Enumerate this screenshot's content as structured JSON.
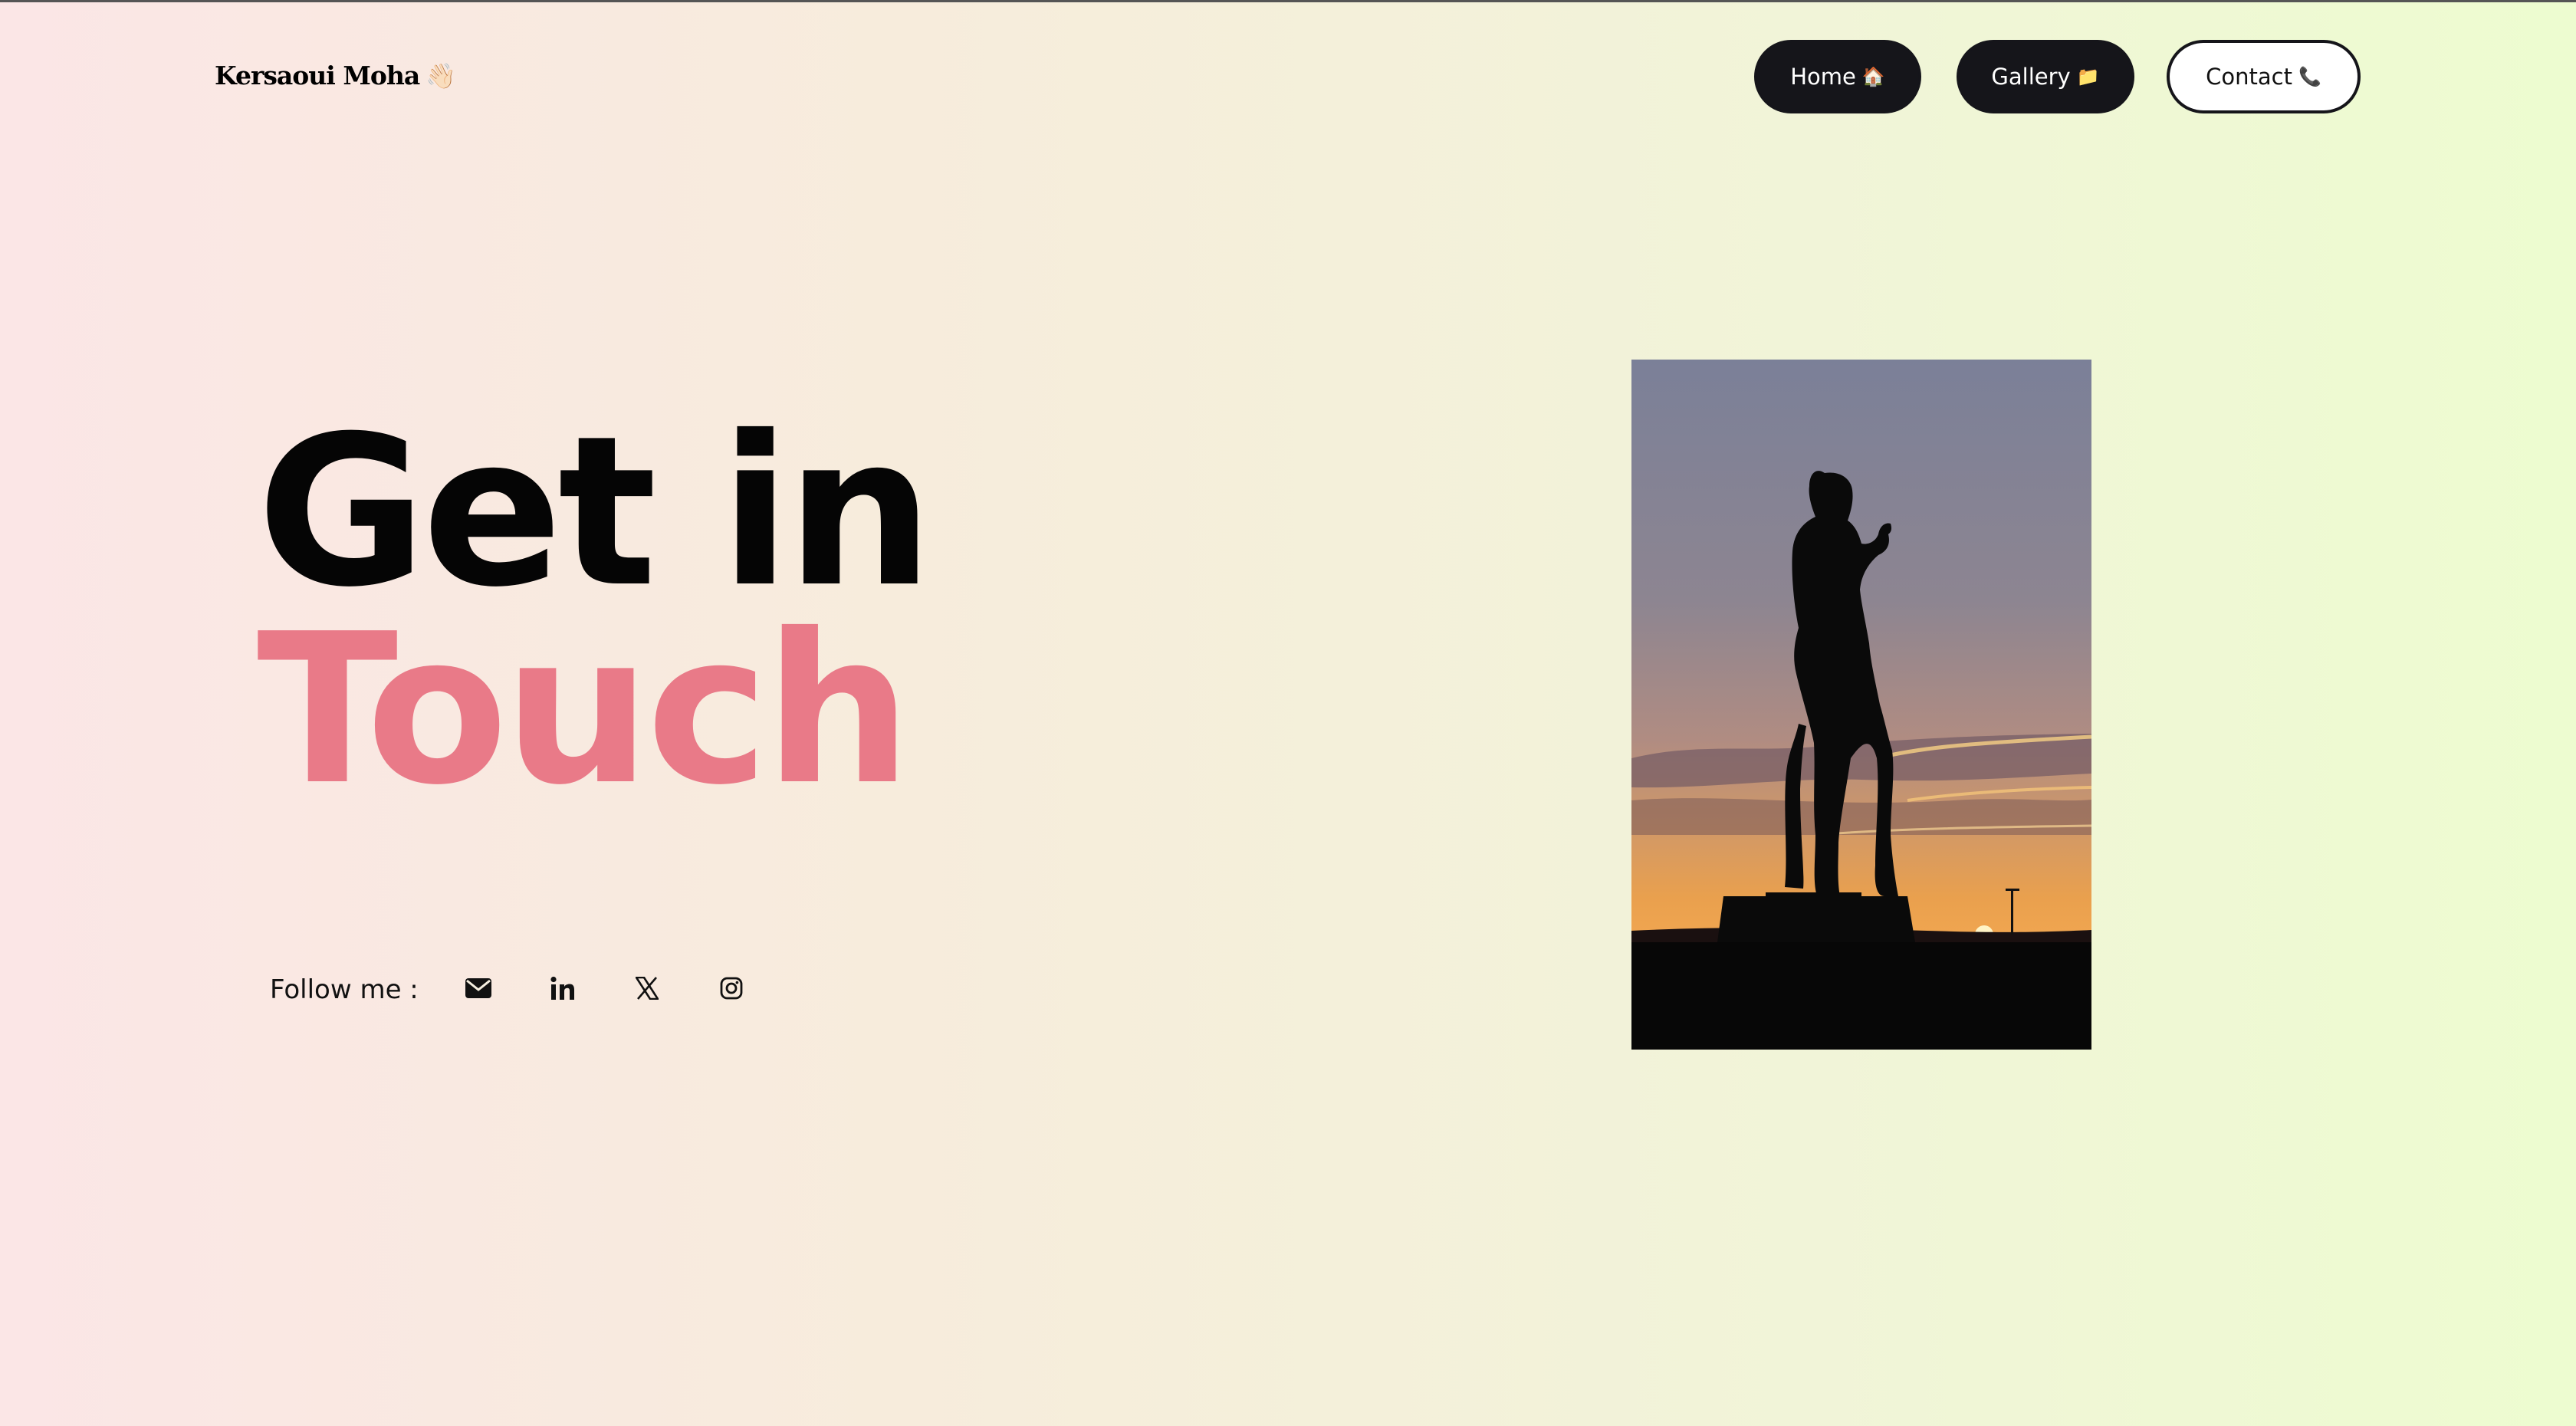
{
  "brand": {
    "name": "Kersaoui Moha",
    "emoji": "👋🏻",
    "icon": "waving-hand-icon"
  },
  "nav": {
    "home": {
      "label": "Home",
      "emoji": "🏠",
      "icon": "house-icon"
    },
    "gallery": {
      "label": "Gallery",
      "emoji": "📁",
      "icon": "folder-icon"
    },
    "contact": {
      "label": "Contact",
      "emoji": "📞",
      "icon": "phone-icon"
    }
  },
  "hero": {
    "line1": "Get in",
    "line2": "Touch"
  },
  "follow": {
    "label": "Follow me :",
    "links": [
      {
        "name": "email",
        "icon": "envelope-icon"
      },
      {
        "name": "linkedin",
        "icon": "linkedin-icon"
      },
      {
        "name": "x",
        "icon": "x-icon"
      },
      {
        "name": "instagram",
        "icon": "instagram-icon"
      }
    ]
  },
  "photo": {
    "subject": "statue silhouette at sunset"
  },
  "colors": {
    "accent": "#e97a88",
    "dark": "#15151a",
    "bg_left": "#fbe6e6",
    "bg_right": "#edfcd0"
  }
}
